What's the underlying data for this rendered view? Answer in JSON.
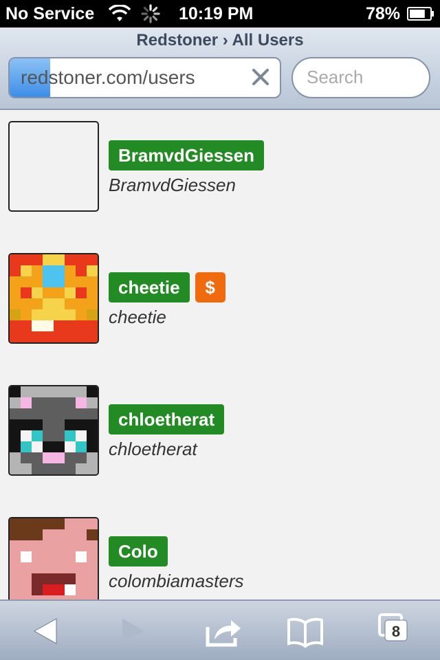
{
  "status_bar": {
    "carrier": "No Service",
    "time": "10:19 PM",
    "battery": "78%",
    "battery_level": 0.78
  },
  "browser": {
    "page_title": "Redstoner › All Users",
    "url": "redstoner.com/users",
    "load_progress": 0.15,
    "search_placeholder": "Search",
    "tabs_count": "8"
  },
  "users": [
    {
      "display_name": "BramvdGiessen",
      "username": "BramvdGiessen",
      "donor": false
    },
    {
      "display_name": "cheetie",
      "username": "cheetie",
      "donor": true,
      "donor_label": "$"
    },
    {
      "display_name": "chloetherat",
      "username": "chloetherat",
      "donor": false
    },
    {
      "display_name": "Colo",
      "username": "colombiamasters",
      "donor": false
    }
  ],
  "colors": {
    "name_badge": "#238b23",
    "donor_badge": "#f06a0e",
    "chrome_top": "#dfe6ef",
    "chrome_bottom": "#b8c5d6"
  },
  "icons": {
    "back": "back-arrow-icon",
    "forward": "forward-arrow-icon",
    "share": "share-icon",
    "bookmarks": "bookmarks-icon",
    "tabs": "tabs-icon"
  }
}
